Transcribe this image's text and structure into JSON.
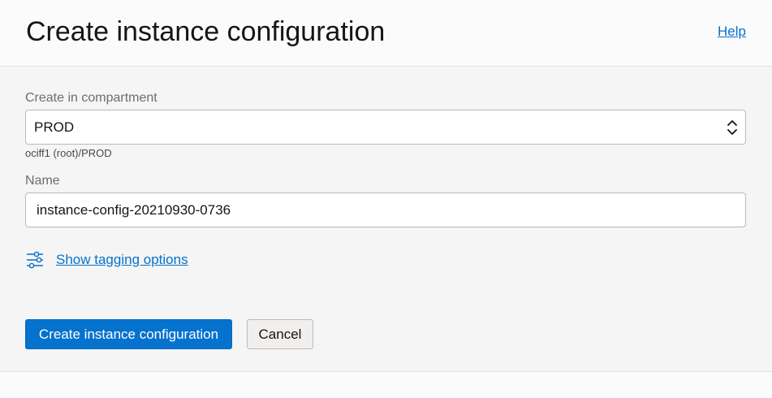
{
  "header": {
    "title": "Create instance configuration",
    "help_label": "Help"
  },
  "form": {
    "compartment": {
      "label": "Create in compartment",
      "value": "PROD",
      "helper": "ociff1 (root)/PROD"
    },
    "name": {
      "label": "Name",
      "value": "instance-config-20210930-0736"
    },
    "tagging": {
      "label": "Show tagging options",
      "icon": "sliders-icon"
    }
  },
  "actions": {
    "primary_label": "Create instance configuration",
    "cancel_label": "Cancel"
  },
  "colors": {
    "accent": "#0572ce",
    "panel_background": "#f5f5f5",
    "header_background": "#fbfbfb"
  }
}
